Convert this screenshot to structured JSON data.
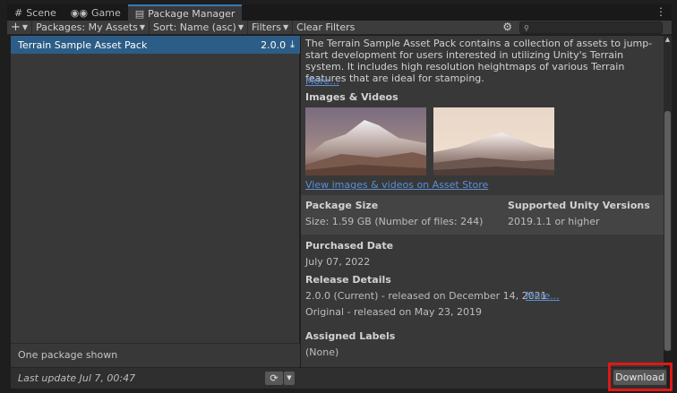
{
  "tabs": [
    {
      "icon": "grid-icon",
      "label": "Scene"
    },
    {
      "icon": "gamepad-icon",
      "label": "Game"
    },
    {
      "icon": "package-icon",
      "label": "Package Manager"
    }
  ],
  "toolbar": {
    "add_label": "+",
    "packages_label": "Packages: My Assets",
    "sort_label": "Sort: Name (asc)",
    "filters_label": "Filters",
    "clear_filters_label": "Clear Filters",
    "search_placeholder": ""
  },
  "package_list": {
    "items": [
      {
        "name": "Terrain Sample Asset Pack",
        "version": "2.0.0"
      }
    ],
    "count_text": "One package shown"
  },
  "bottom": {
    "last_update": "Last update Jul 7, 00:47",
    "download_label": "Download"
  },
  "details": {
    "description": "The Terrain Sample Asset Pack contains a collection of assets to jump-start development for users interested in utilizing Unity's Terrain system. It includes high resolution heightmaps of various Terrain features that are ideal for stamping.",
    "more_label": "More...",
    "images_title": "Images & Videos",
    "media_link": "View images & videos on Asset Store",
    "package_size_title": "Package Size",
    "package_size_value": "Size: 1.59 GB (Number of files: 244)",
    "unity_versions_title": "Supported Unity Versions",
    "unity_versions_value": "2019.1.1 or higher",
    "purchased_title": "Purchased Date",
    "purchased_value": "July 07, 2022",
    "release_title": "Release Details",
    "release_current": "2.0.0 (Current) - released on December 14, 2021",
    "release_more": "More...",
    "release_original": "Original - released on May 23, 2019",
    "labels_title": "Assigned Labels",
    "labels_value": "(None)"
  },
  "colors": {
    "selection": "#2c5d87",
    "link": "#5b8fd6",
    "highlight": "#e01818",
    "panel": "#383838"
  }
}
